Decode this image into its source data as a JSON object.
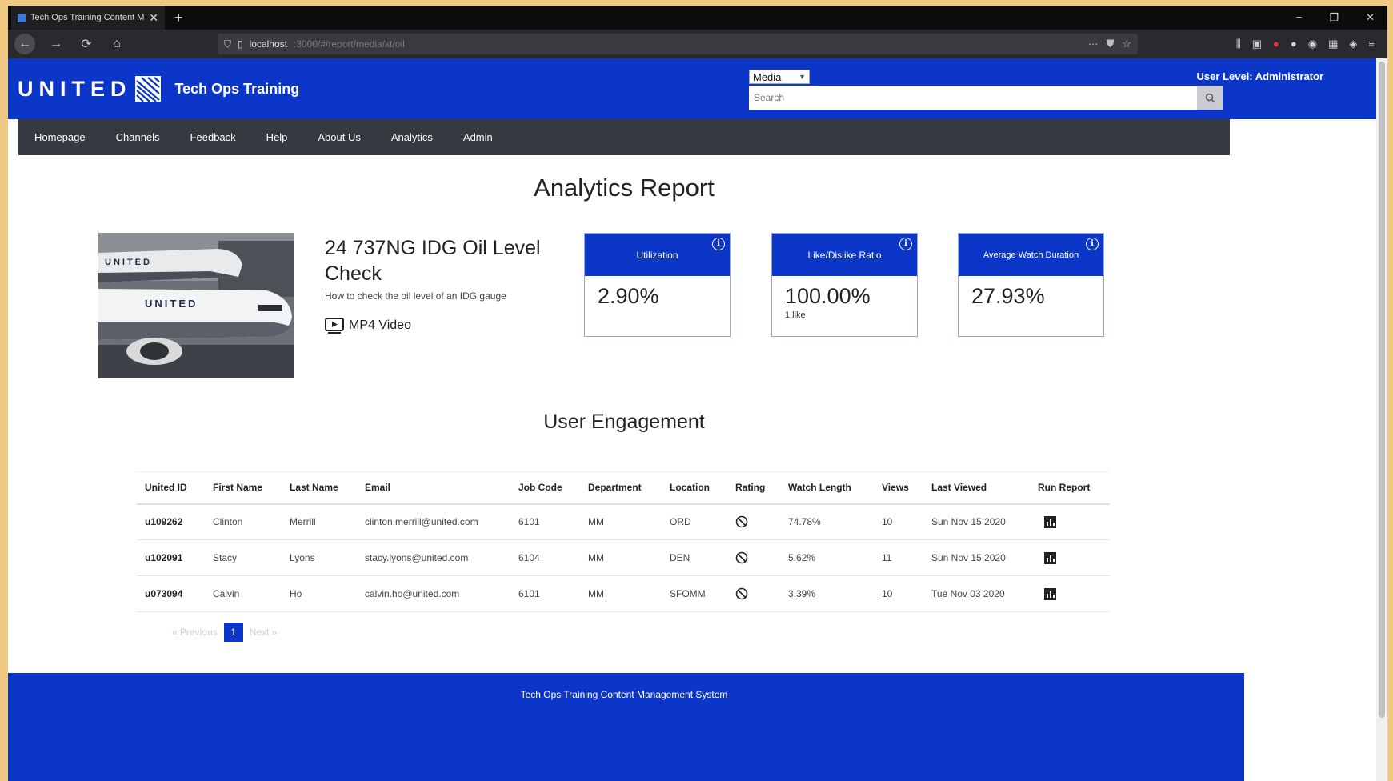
{
  "browser": {
    "tab_title": "Tech Ops Training Content M...",
    "url_host": "localhost",
    "url_path": ":3000/#/report/media/kt/oil",
    "new_tab": "+",
    "tab_close": "✕"
  },
  "header": {
    "logo_text": "UNITED",
    "site_title": "Tech Ops Training",
    "media_select_value": "Media",
    "search_placeholder": "Search",
    "user_level": "User Level: Administrator"
  },
  "nav": {
    "items": [
      "Homepage",
      "Channels",
      "Feedback",
      "Help",
      "About Us",
      "Analytics",
      "Admin"
    ]
  },
  "main": {
    "page_title": "Analytics Report",
    "video": {
      "title": "24 737NG IDG Oil Level Check",
      "description": "How to check the oil level of an IDG gauge",
      "type_label": "MP4 Video"
    },
    "metrics": [
      {
        "label": "Utilization",
        "value": "2.90%",
        "sub": ""
      },
      {
        "label": "Like/Dislike Ratio",
        "value": "100.00%",
        "sub": "1 like"
      },
      {
        "label": "Average Watch Duration",
        "value": "27.93%",
        "sub": ""
      }
    ],
    "engagement_title": "User Engagement",
    "table": {
      "columns": [
        "United ID",
        "First Name",
        "Last Name",
        "Email",
        "Job Code",
        "Department",
        "Location",
        "Rating",
        "Watch Length",
        "Views",
        "Last Viewed",
        "Run Report"
      ],
      "rows": [
        {
          "id": "u109262",
          "first": "Clinton",
          "last": "Merrill",
          "email": "clinton.merrill@united.com",
          "job": "6101",
          "dept": "MM",
          "loc": "ORD",
          "watch": "74.78%",
          "views": "10",
          "last_viewed": "Sun Nov 15 2020"
        },
        {
          "id": "u102091",
          "first": "Stacy",
          "last": "Lyons",
          "email": "stacy.lyons@united.com",
          "job": "6104",
          "dept": "MM",
          "loc": "DEN",
          "watch": "5.62%",
          "views": "11",
          "last_viewed": "Sun Nov 15 2020"
        },
        {
          "id": "u073094",
          "first": "Calvin",
          "last": "Ho",
          "email": "calvin.ho@united.com",
          "job": "6101",
          "dept": "MM",
          "loc": "SFOMM",
          "watch": "3.39%",
          "views": "10",
          "last_viewed": "Tue Nov 03 2020"
        }
      ]
    },
    "pagination": {
      "previous": "« Previous",
      "current": "1",
      "next": "Next »"
    }
  },
  "footer": {
    "text": "Tech Ops Training Content Management System"
  },
  "colors": {
    "brand_blue": "#0b36c8",
    "nav_dark": "#343a40"
  }
}
